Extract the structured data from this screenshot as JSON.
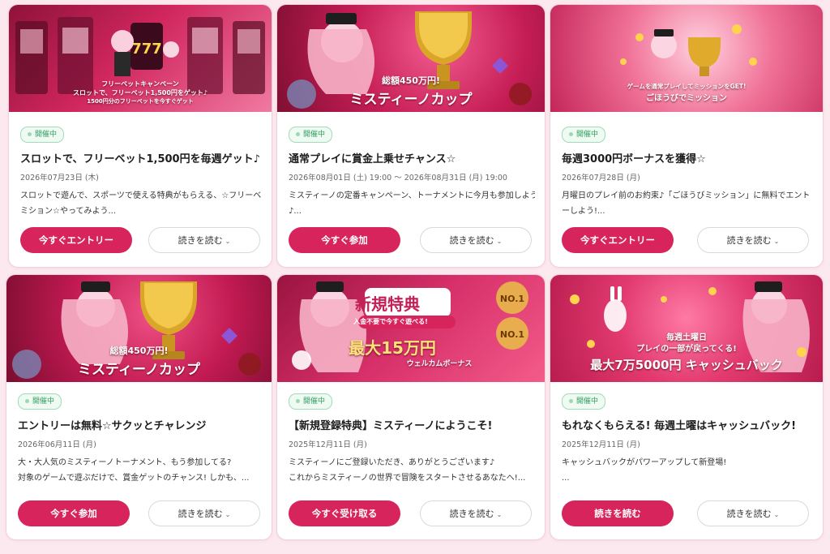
{
  "cards": [
    {
      "banner": {
        "line1": "フリーベットキャンペーン",
        "line2": "スロットで、フリーベット1,500円をゲット♪",
        "line3": "1500円分のフリーベットを今すぐゲット"
      },
      "status": "開催中",
      "title": "スロットで、フリーベット1,500円を毎週ゲット♪",
      "date": "2026年07月23日 (木)",
      "desc": [
        "スロットで遊んで、スポーツで使える特典がもらえる、☆フリーベッ",
        "ミション☆やってみよう..."
      ],
      "primary_label": "今すぐエントリー",
      "secondary_label": "読きを読む"
    },
    {
      "banner": {
        "line1": "総額450万円!",
        "line2": "ミスティーノカップ"
      },
      "status": "開催中",
      "title": "通常プレイに賞金上乗せチャンス☆",
      "date": "2026年08月01日 (土) 19:00 ～ 2026年08月31日 (月) 19:00",
      "desc": [
        "ミスティーノの定番キャンペーン、トーナメントに今月も参加しよう",
        "♪..."
      ],
      "primary_label": "今すぐ参加",
      "secondary_label": "読きを読む"
    },
    {
      "banner": {
        "line1": "ゲームを通常プレイしてミッションをGET!",
        "line2": "ごほうびでミッション"
      },
      "status": "開催中",
      "title": "毎週3000円ボーナスを獲得☆",
      "date": "2026年07月28日 (月)",
      "desc": [
        "月曜日のプレイ前のお約束♪「ごほうびミッション」に無料でエント",
        "ーしよう!..."
      ],
      "primary_label": "今すぐエントリー",
      "secondary_label": "読きを読む"
    },
    {
      "banner": {
        "line1": "総額450万円!",
        "line2": "ミスティーノカップ"
      },
      "status": "開催中",
      "title": "エントリーは無料☆サクッとチャレンジ",
      "date": "2026年06月11日 (月)",
      "desc": [
        "大・大人気のミスティーノトーナメント、もう参加してる?",
        "対象のゲームで遊ぶだけで、賞金ゲットのチャンス! しかも、..."
      ],
      "primary_label": "今すぐ参加",
      "secondary_label": "読きを読む"
    },
    {
      "banner": {
        "line1": "新規特典",
        "line2": "入金不要で今すぐ遊べる!",
        "line3": "最大15万円",
        "line4": "ウェルカムボーナス"
      },
      "status": "開催中",
      "title": "【新規登録特典】ミスティーノにようこそ!",
      "date": "2025年12月11日 (月)",
      "desc": [
        "ミスティーノにご登録いただき、ありがとうございます♪",
        "これからミスティーノの世界で冒険をスタートさせるあなたへ!..."
      ],
      "primary_label": "今すぐ受け取る",
      "secondary_label": "読きを読む"
    },
    {
      "banner": {
        "line1": "毎週土曜日",
        "line2": "プレイの一部が戻ってくる!",
        "line3": "最大7万5000円 キャッシュバック"
      },
      "status": "開催中",
      "title": "もれなくもらえる! 毎週土曜はキャッシュバック!",
      "date": "2025年12月11日 (月)",
      "desc": [
        "キャッシュバックがパワーアップして新登場!",
        "..."
      ],
      "primary_label": "読きを読む",
      "secondary_label": "読きを読む"
    }
  ],
  "icons": {
    "chevron": "chevron-down-icon",
    "status_dot": "status-dot-icon"
  },
  "colors": {
    "primary": "#d8245d",
    "badge_green": "#2e9d5e",
    "page_bg": "#fbe9ef"
  }
}
